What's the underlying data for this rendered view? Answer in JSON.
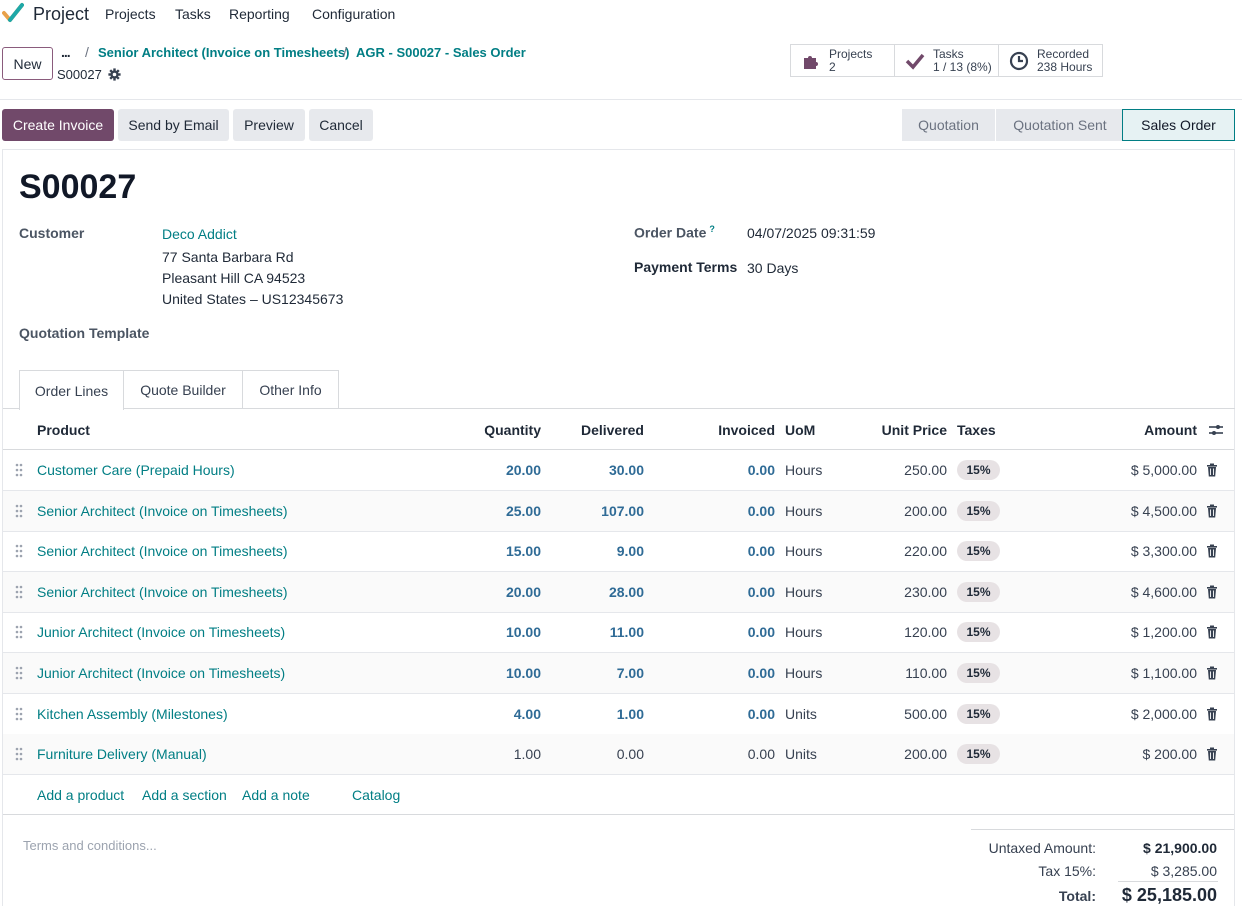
{
  "app": {
    "name": "Project",
    "menu": [
      "Projects",
      "Tasks",
      "Reporting",
      "Configuration"
    ]
  },
  "control": {
    "new_label": "New",
    "more": "...",
    "breadcrumbs": [
      "Senior Architect (Invoice on Timesheets)",
      "AGR - S00027 - Sales Order"
    ],
    "breadcrumb_sep": "/",
    "record_name": "S00027"
  },
  "smart_buttons": [
    {
      "icon": "puzzle-icon",
      "title": "Projects",
      "value": "2"
    },
    {
      "icon": "check-icon",
      "title": "Tasks",
      "value": "1 / 13 (8%)"
    },
    {
      "icon": "clock-icon",
      "title": "Recorded",
      "value": "238 Hours"
    }
  ],
  "actions": {
    "create_invoice": "Create Invoice",
    "send_email": "Send by Email",
    "preview": "Preview",
    "cancel": "Cancel"
  },
  "status": {
    "steps": [
      "Quotation",
      "Quotation Sent",
      "Sales Order"
    ],
    "active": "Sales Order"
  },
  "form": {
    "title": "S00027",
    "customer_label": "Customer",
    "customer_name": "Deco Addict",
    "address": [
      "77 Santa Barbara Rd",
      "Pleasant Hill CA 94523",
      "United States – US12345673"
    ],
    "order_date_label": "Order Date",
    "help_mark": "?",
    "order_date": "04/07/2025 09:31:59",
    "payment_terms_label": "Payment Terms",
    "payment_terms": "30 Days",
    "quotation_template_label": "Quotation Template"
  },
  "tabs": [
    "Order Lines",
    "Quote Builder",
    "Other Info"
  ],
  "table": {
    "headers": {
      "product": "Product",
      "quantity": "Quantity",
      "delivered": "Delivered",
      "invoiced": "Invoiced",
      "uom": "UoM",
      "unit_price": "Unit Price",
      "taxes": "Taxes",
      "amount": "Amount"
    },
    "rows": [
      {
        "product": "Customer Care (Prepaid Hours)",
        "quantity": "20.00",
        "delivered": "30.00",
        "invoiced": "0.00",
        "uom": "Hours",
        "unit_price": "250.00",
        "tax": "15%",
        "amount": "$ 5,000.00"
      },
      {
        "product": "Senior Architect (Invoice on Timesheets)",
        "quantity": "25.00",
        "delivered": "107.00",
        "invoiced": "0.00",
        "uom": "Hours",
        "unit_price": "200.00",
        "tax": "15%",
        "amount": "$ 4,500.00"
      },
      {
        "product": "Senior Architect (Invoice on Timesheets)",
        "quantity": "15.00",
        "delivered": "9.00",
        "invoiced": "0.00",
        "uom": "Hours",
        "unit_price": "220.00",
        "tax": "15%",
        "amount": "$ 3,300.00"
      },
      {
        "product": "Senior Architect (Invoice on Timesheets)",
        "quantity": "20.00",
        "delivered": "28.00",
        "invoiced": "0.00",
        "uom": "Hours",
        "unit_price": "230.00",
        "tax": "15%",
        "amount": "$ 4,600.00"
      },
      {
        "product": "Junior Architect (Invoice on Timesheets)",
        "quantity": "10.00",
        "delivered": "11.00",
        "invoiced": "0.00",
        "uom": "Hours",
        "unit_price": "120.00",
        "tax": "15%",
        "amount": "$ 1,200.00"
      },
      {
        "product": "Junior Architect (Invoice on Timesheets)",
        "quantity": "10.00",
        "delivered": "7.00",
        "invoiced": "0.00",
        "uom": "Hours",
        "unit_price": "110.00",
        "tax": "15%",
        "amount": "$ 1,100.00"
      },
      {
        "product": "Kitchen Assembly (Milestones)",
        "quantity": "4.00",
        "delivered": "1.00",
        "invoiced": "0.00",
        "uom": "Units",
        "unit_price": "500.00",
        "tax": "15%",
        "amount": "$ 2,000.00"
      },
      {
        "product": "Furniture Delivery (Manual)",
        "quantity": "1.00",
        "delivered": "0.00",
        "invoiced": "0.00",
        "uom": "Units",
        "unit_price": "200.00",
        "tax": "15%",
        "amount": "$ 200.00"
      }
    ],
    "add_links": [
      "Add a product",
      "Add a section",
      "Add a note",
      "Catalog"
    ]
  },
  "footer": {
    "terms_placeholder": "Terms and conditions...",
    "untaxed_label": "Untaxed Amount:",
    "untaxed_value": "$ 21,900.00",
    "tax_label": "Tax 15%:",
    "tax_value": "$ 3,285.00",
    "total_label": "Total:",
    "total_value": "$ 25,185.00"
  },
  "colors": {
    "primary": "#71496a",
    "link": "#017e84",
    "numeric": "#2f6b96"
  }
}
